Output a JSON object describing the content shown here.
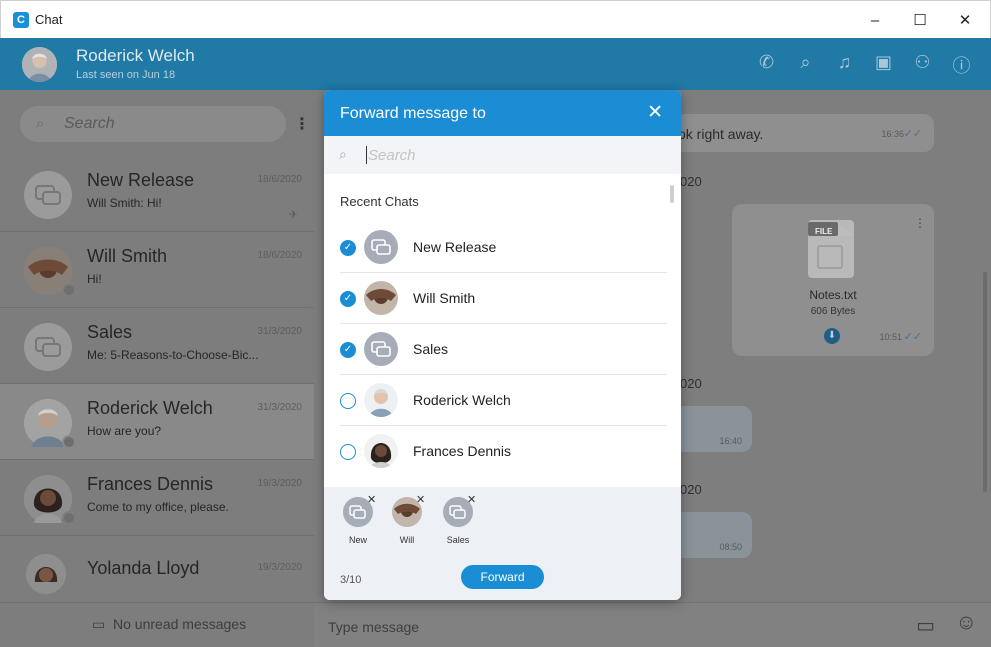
{
  "window": {
    "title": "Chat"
  },
  "header": {
    "name": "Roderick Welch",
    "status": "Last seen on Jun 18"
  },
  "sidebar": {
    "search_placeholder": "Search",
    "chats": [
      {
        "name": "New Release",
        "message": "Will Smith: Hi!",
        "date": "18/6/2020"
      },
      {
        "name": "Will Smith",
        "message": "Hi!",
        "date": "18/6/2020"
      },
      {
        "name": "Sales",
        "message": "Me: 5-Reasons-to-Choose-Bic...",
        "date": "31/3/2020"
      },
      {
        "name": "Roderick Welch",
        "message": "How are you?",
        "date": "31/3/2020"
      },
      {
        "name": "Frances Dennis",
        "message": "Come to my office, please.",
        "date": "19/3/2020"
      },
      {
        "name": "Yolanda Lloyd",
        "message": "",
        "date": "19/3/2020"
      }
    ],
    "footer": "No unread messages"
  },
  "main": {
    "msg1_text": "ok right away.",
    "msg1_time": "16:36",
    "date_sep_1": "020",
    "file": {
      "badge": "FILE",
      "name": "Notes.txt",
      "size": "606 Bytes",
      "time": "10:51"
    },
    "date_sep_2": "020",
    "msg2_time": "16:40",
    "date_sep_3": "020",
    "msg3_time": "08:50",
    "input_placeholder": "Type message"
  },
  "modal": {
    "title": "Forward message to",
    "search_placeholder": "Search",
    "section": "Recent Chats",
    "items": [
      {
        "name": "New Release",
        "checked": true
      },
      {
        "name": "Will Smith",
        "checked": true
      },
      {
        "name": "Sales",
        "checked": true
      },
      {
        "name": "Roderick Welch",
        "checked": false
      },
      {
        "name": "Frances Dennis",
        "checked": false
      }
    ],
    "selected": [
      {
        "label": "New"
      },
      {
        "label": "Will"
      },
      {
        "label": "Sales"
      }
    ],
    "count": "3/10",
    "forward_label": "Forward"
  },
  "colors": {
    "accent": "#1b8dd4",
    "header": "#2179a6"
  }
}
